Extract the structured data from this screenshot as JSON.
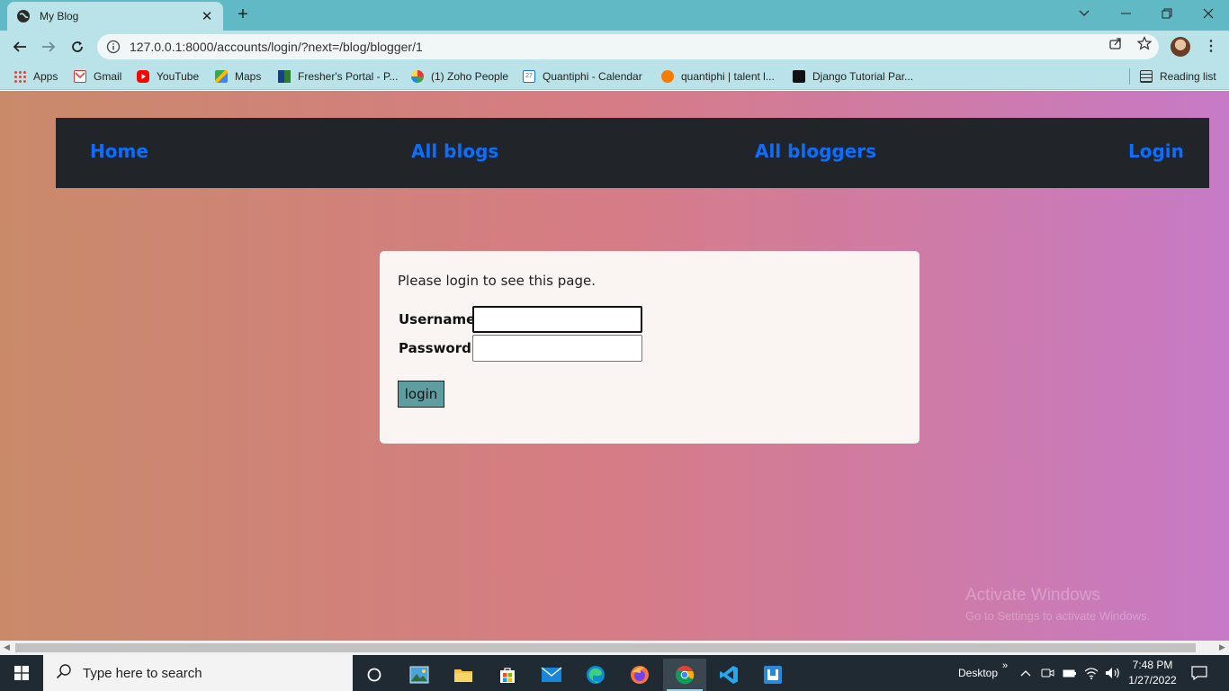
{
  "browser": {
    "tab_title": "My Blog",
    "url": "127.0.0.1:8000/accounts/login/?next=/blog/blogger/1"
  },
  "bookmarks": [
    {
      "label": "Apps",
      "icon": "apps-grid-icon"
    },
    {
      "label": "Gmail",
      "icon": "gmail-icon"
    },
    {
      "label": "YouTube",
      "icon": "youtube-icon"
    },
    {
      "label": "Maps",
      "icon": "maps-icon"
    },
    {
      "label": "Fresher's Portal - P...",
      "icon": "portal-icon"
    },
    {
      "label": "(1) Zoho People",
      "icon": "zoho-icon"
    },
    {
      "label": "Quantiphi - Calendar",
      "icon": "calendar-icon"
    },
    {
      "label": "quantiphi | talent l...",
      "icon": "talent-icon"
    },
    {
      "label": "Django Tutorial Par...",
      "icon": "django-icon"
    }
  ],
  "reading_list": "Reading list",
  "site_nav": {
    "home": "Home",
    "all_blogs": "All blogs",
    "all_bloggers": "All bloggers",
    "login": "Login",
    "link_color": "#0d6efd"
  },
  "login_form": {
    "message": "Please login to see this page.",
    "username_label": "Username:",
    "password_label": "Password:",
    "username_value": "",
    "password_value": "",
    "submit_label": "login"
  },
  "watermark": {
    "line1": "Activate Windows",
    "line2": "Go to Settings to activate Windows."
  },
  "taskbar": {
    "search_placeholder": "Type here to search",
    "desktop_label": "Desktop",
    "time": "7:48 PM",
    "date": "1/27/2022"
  }
}
